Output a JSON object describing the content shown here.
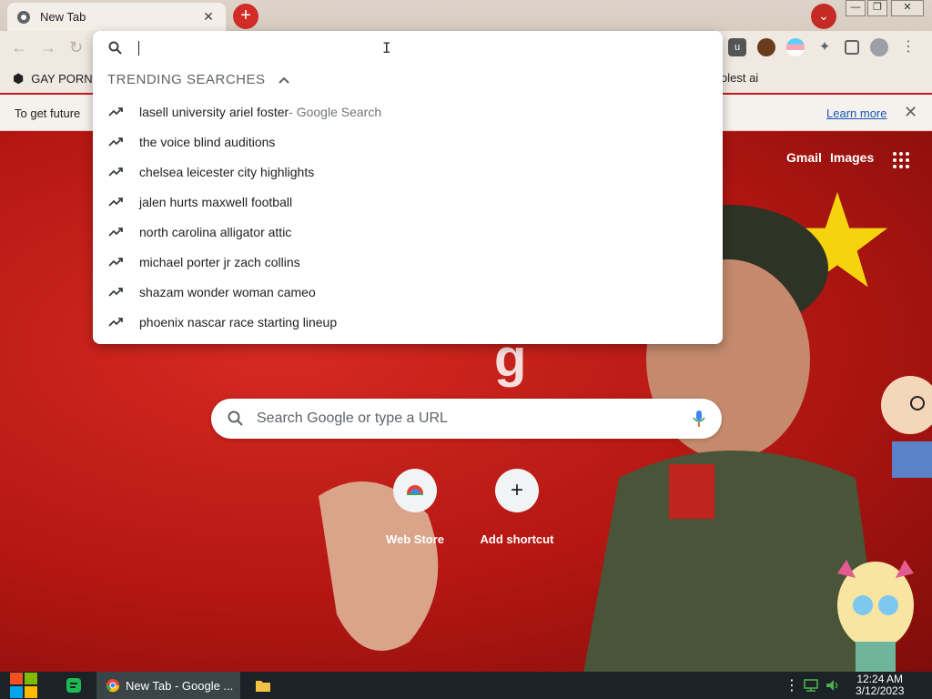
{
  "tab": {
    "title": "New Tab"
  },
  "window": {
    "new_tab_symbol": "+",
    "tab_search_symbol": "⌄",
    "minimize": "—",
    "restore": "❐",
    "close": "✕"
  },
  "bookmarks": {
    "first_label": "GAY PORN",
    "right_label": "olest ai"
  },
  "infobar": {
    "message": "To get future",
    "learn_more": "Learn more"
  },
  "omnibox": {
    "header": "TRENDING SEARCHES",
    "suggestions": [
      {
        "text": "lasell university ariel foster",
        "suffix": " - Google Search"
      },
      {
        "text": "the voice blind auditions",
        "suffix": ""
      },
      {
        "text": "chelsea leicester city highlights",
        "suffix": ""
      },
      {
        "text": "jalen hurts maxwell football",
        "suffix": ""
      },
      {
        "text": "north carolina alligator attic",
        "suffix": ""
      },
      {
        "text": "michael porter jr zach collins",
        "suffix": ""
      },
      {
        "text": "shazam wonder woman cameo",
        "suffix": ""
      },
      {
        "text": "phoenix nascar race starting lineup",
        "suffix": ""
      }
    ]
  },
  "page": {
    "gmail": "Gmail",
    "images": "Images",
    "logo_fragment": "g",
    "search_placeholder": "Search Google or type a URL",
    "shortcuts": [
      {
        "label": "Web Store"
      },
      {
        "label": "Add shortcut",
        "symbol": "+"
      }
    ]
  },
  "taskbar": {
    "chrome_label": "New Tab - Google ...",
    "time": "12:24 AM",
    "date": "3/12/2023"
  },
  "colors": {
    "accent_red": "#d22c27",
    "link_blue": "#1a57b8"
  }
}
